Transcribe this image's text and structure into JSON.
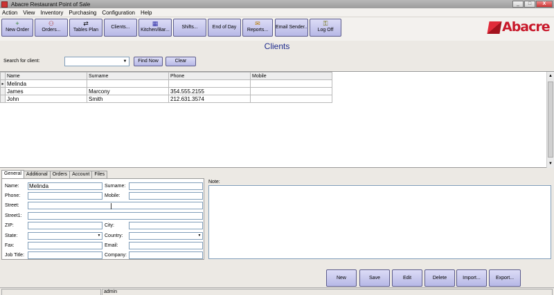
{
  "window": {
    "title": "Abacre Restaurant Point of Sale",
    "minimize": "_",
    "maximize": "□",
    "close": "X"
  },
  "menu": [
    "Action",
    "View",
    "Inventory",
    "Purchasing",
    "Configuration",
    "Help"
  ],
  "toolbar": [
    {
      "label": "New Order",
      "icon": "+"
    },
    {
      "label": "Orders...",
      "icon": "⚇"
    },
    {
      "label": "Tables Plan",
      "icon": "⇄"
    },
    {
      "label": "Clients...",
      "icon": ""
    },
    {
      "label": "Kitchen/Bar...",
      "icon": "▦"
    },
    {
      "label": "Shifts...",
      "icon": ""
    },
    {
      "label": "End of Day",
      "icon": ""
    },
    {
      "label": "Reports...",
      "icon": "✉"
    },
    {
      "label": "Email Sender...",
      "icon": ""
    },
    {
      "label": "Log Off",
      "icon": "⚿"
    }
  ],
  "logo": {
    "text": "Abacre",
    "color": "#c8192b"
  },
  "page_title": "Clients",
  "search": {
    "label": "Search for client:",
    "value": "",
    "find_label": "Find Now",
    "clear_label": "Clear"
  },
  "grid": {
    "columns": [
      "Name",
      "Surname",
      "Phone",
      "Mobile"
    ],
    "rows": [
      {
        "indicator": "▸",
        "name": "Melinda",
        "surname": "",
        "phone": "",
        "mobile": ""
      },
      {
        "indicator": "",
        "name": "James",
        "surname": "Marcony",
        "phone": "354.555.2155",
        "mobile": ""
      },
      {
        "indicator": "",
        "name": "John",
        "surname": "Smith",
        "phone": "212.631.3574",
        "mobile": ""
      }
    ]
  },
  "tabs": [
    "General",
    "Additional",
    "Orders",
    "Account",
    "Files"
  ],
  "form": {
    "name_label": "Name:",
    "name_value": "Melinda",
    "surname_label": "Surname:",
    "surname_value": "",
    "phone_label": "Phone:",
    "phone_value": "",
    "mobile_label": "Mobile:",
    "mobile_value": "",
    "street_label": "Street:",
    "street_value": "",
    "street1_label": "Street1:",
    "street1_value": "",
    "zip_label": "ZIP:",
    "zip_value": "",
    "city_label": "City:",
    "city_value": "",
    "state_label": "State:",
    "state_value": "",
    "country_label": "Country:",
    "country_value": "",
    "fax_label": "Fax:",
    "fax_value": "",
    "email_label": "Email:",
    "email_value": "",
    "jobtitle_label": "Job Title:",
    "jobtitle_value": "",
    "company_label": "Company:",
    "company_value": "",
    "note_label": "Note:",
    "note_value": ""
  },
  "actions": [
    "New",
    "Save",
    "Edit",
    "Delete",
    "Import...",
    "Export..."
  ],
  "status": {
    "user": "admin"
  },
  "colors": {
    "title_blue": "#1d2a8b",
    "button_face": "#c8c9ee",
    "brand_red": "#c8192b"
  }
}
